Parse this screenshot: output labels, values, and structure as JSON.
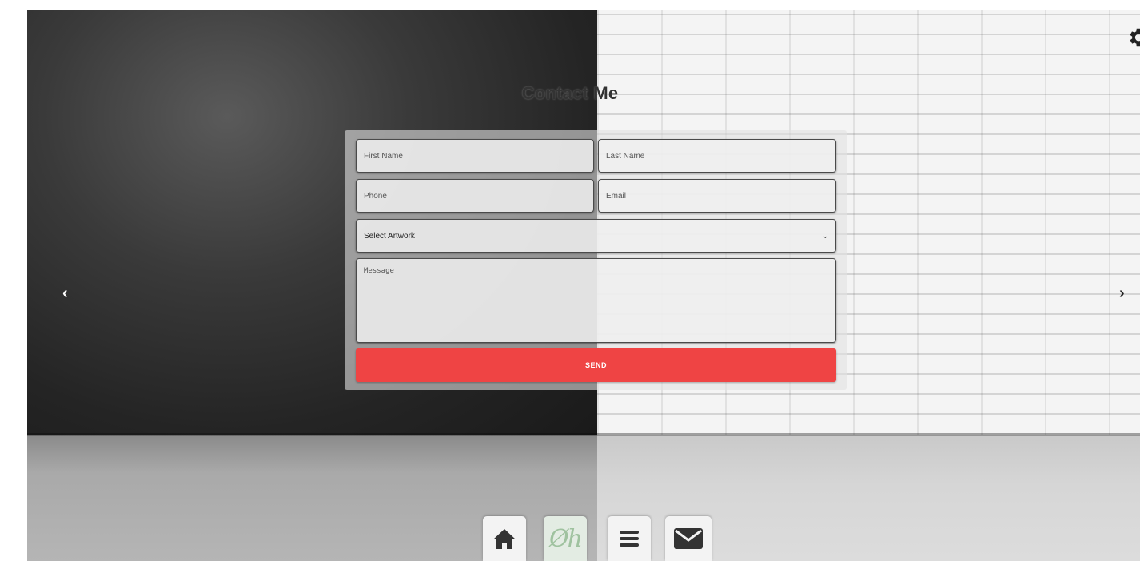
{
  "page": {
    "title": "Contact Me"
  },
  "form": {
    "first_name_placeholder": "First Name",
    "last_name_placeholder": "Last Name",
    "phone_placeholder": "Phone",
    "email_placeholder": "Email",
    "artwork_select_value": "Select Artwork",
    "message_placeholder": "Message",
    "send_label": "SEND"
  },
  "nav": {
    "prev_glyph": "‹",
    "next_glyph": "›"
  },
  "dock": {
    "logo_text": "Øh",
    "items": [
      "home-icon",
      "logo",
      "menu-icon",
      "mail-icon"
    ]
  },
  "icons": {
    "settings": "gear-icon",
    "select_chevron": "chevron-down-icon"
  },
  "colors": {
    "send_button": "#ef4444",
    "logo": "#9fc29f",
    "title": "#333333"
  }
}
